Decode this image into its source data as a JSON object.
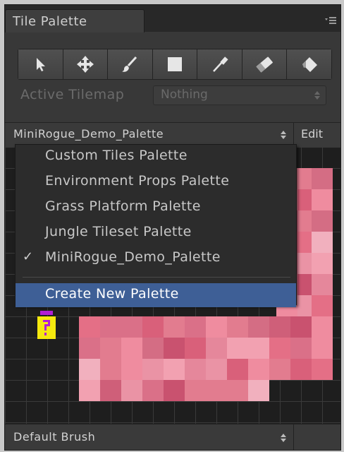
{
  "window": {
    "tab_title": "Tile Palette",
    "menu_icon": "menu-lines-icon"
  },
  "toolbar": {
    "tools": [
      {
        "name": "select-tool",
        "icon": "arrow-cursor-icon"
      },
      {
        "name": "move-tool",
        "icon": "move-arrows-icon"
      },
      {
        "name": "paint-tool",
        "icon": "brush-icon"
      },
      {
        "name": "box-fill-tool",
        "icon": "square-icon"
      },
      {
        "name": "picker-tool",
        "icon": "eyedropper-icon"
      },
      {
        "name": "erase-tool",
        "icon": "eraser-icon"
      },
      {
        "name": "flood-fill-tool",
        "icon": "paint-bucket-icon"
      }
    ]
  },
  "active_tilemap": {
    "label": "Active Tilemap",
    "value": "Nothing"
  },
  "palette_bar": {
    "selected": "MiniRogue_Demo_Palette",
    "edit_label": "Edit"
  },
  "palette_dropdown": {
    "items": [
      {
        "label": "Custom Tiles Palette",
        "checked": false
      },
      {
        "label": "Environment Props Palette",
        "checked": false
      },
      {
        "label": "Grass Platform Palette",
        "checked": false
      },
      {
        "label": "Jungle Tileset Palette",
        "checked": false
      },
      {
        "label": "MiniRogue_Demo_Palette",
        "checked": true
      }
    ],
    "check_mark": "✓",
    "create_label": "Create New Palette"
  },
  "brush_bar": {
    "selected": "Default Brush"
  },
  "colors": {
    "window_bg": "#383838",
    "selection_blue": "#3e5f96",
    "tile_pink": "#e46f86",
    "coin_yellow": "#f5e90e",
    "coin_magenta": "#b21fd4"
  }
}
